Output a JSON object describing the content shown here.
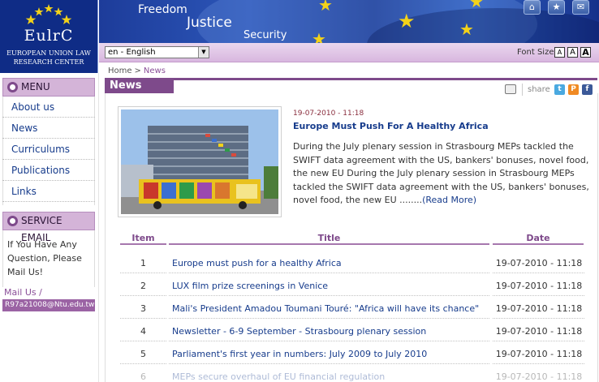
{
  "logo": {
    "name": "EulrC",
    "subtitle_line1": "EUROPEAN UNION LAW",
    "subtitle_line2": "RESEARCH CENTER"
  },
  "banner": {
    "words": [
      "Freedom",
      "Justice",
      "Security"
    ],
    "icons": [
      "home-icon",
      "star-icon",
      "mail-icon"
    ]
  },
  "toolbar": {
    "language": "en - English",
    "font_size_label": "Font Size",
    "font_buttons": [
      "A",
      "A",
      "A"
    ]
  },
  "breadcrumb": {
    "home": "Home",
    "separator": ">",
    "current": "News"
  },
  "sidebar": {
    "menu_title": "MENU",
    "items": [
      {
        "label": "About us"
      },
      {
        "label": "News"
      },
      {
        "label": "Curriculums"
      },
      {
        "label": "Publications"
      },
      {
        "label": "Links"
      }
    ],
    "email_title": "SERVICE EMAIL",
    "email_text": "If You Have Any Question, Please Mail Us!",
    "mail_us_label": "Mail Us /",
    "email_address": "R97a21008@Ntu.edu.tw"
  },
  "news": {
    "tab_label": "News",
    "share_label": "share",
    "featured": {
      "date": "19-07-2010 - 11:18",
      "title": "Europe Must Push For A Healthy Africa",
      "body": "During the July plenary session in Strasbourg MEPs tackled the SWIFT data agreement with the US, bankers' bonuses, novel food, the new EU During the July plenary session in Strasbourg MEPs tackled the SWIFT data agreement with the US, bankers' bonuses, novel food, the new EU ........",
      "read_more": "(Read More)"
    },
    "table": {
      "headers": {
        "item": "Item",
        "title": "Title",
        "date": "Date"
      },
      "rows": [
        {
          "item": "1",
          "title": "Europe must push for a healthy Africa",
          "date": "19-07-2010 - 11:18"
        },
        {
          "item": "2",
          "title": "LUX film prize screenings in Venice",
          "date": "19-07-2010 - 11:18"
        },
        {
          "item": "3",
          "title": "Mali's President Amadou Toumani Touré: \"Africa will have its chance\"",
          "date": "19-07-2010 - 11:18"
        },
        {
          "item": "4",
          "title": "Newsletter - 6-9 September - Strasbourg plenary session",
          "date": "19-07-2010 - 11:18"
        },
        {
          "item": "5",
          "title": "Parliament's first year in numbers: July 2009 to July 2010",
          "date": "19-07-2010 - 11:18"
        },
        {
          "item": "6",
          "title": "MEPs secure overhaul of EU financial regulation",
          "date": "19-07-2010 - 11:18"
        }
      ]
    }
  },
  "colors": {
    "brand_purple": "#7e4a8b",
    "lilac": "#d4b4d8",
    "link_blue": "#173c8c",
    "banner_blue": "#1d3c9a",
    "star_yellow": "#f3d219"
  }
}
